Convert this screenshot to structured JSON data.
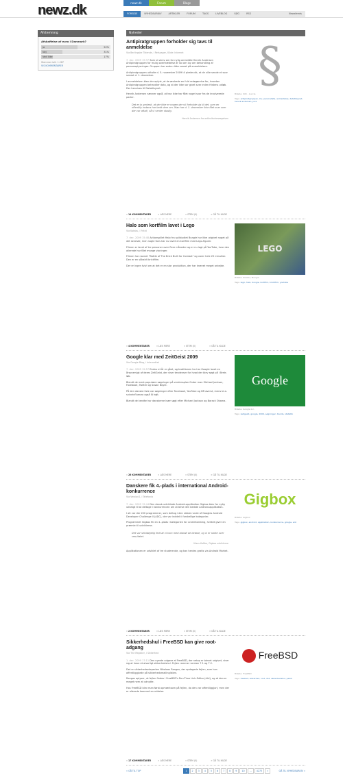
{
  "site": {
    "logo": "newz.dk",
    "top_tabs": [
      {
        "label": "newz.dk",
        "color": "#3a7ab8"
      },
      {
        "label": "Forum",
        "color": "#8fbf3a"
      },
      {
        "label": "Blogs",
        "color": "#999999"
      }
    ],
    "nav": [
      "FORSIDE",
      "NYHEDSARKIV",
      "ARTIKLER",
      "FORUM",
      "TAGS",
      "LIVEBLOG",
      "SØG",
      "RSS"
    ],
    "nav_right": "Newsfeeds"
  },
  "sidebar": {
    "title": "Afstemning",
    "question": "Afskaffelse af euro i Danmark?",
    "options": [
      {
        "label": "Ja",
        "percent": 52,
        "pct_text": "52%"
      },
      {
        "label": "Nej",
        "percent": 31,
        "pct_text": "31%"
      },
      {
        "label": "Ved ikke",
        "percent": 17,
        "pct_text": "17%"
      }
    ],
    "votes": "Stemmer ialt: 1.287",
    "link": "VIS KOMMENTARER"
  },
  "main": {
    "section_title": "Nyheder",
    "articles": [
      {
        "title": "Antipiratgruppen forholder sig tavs til anmeldelse",
        "meta": "Via Berlingske Tidende, i Retssager, Kilde: Internet",
        "date": "7. dec. 2009 19:37",
        "paragraphs": [
          "Som vi skrev om for nylig anmeldte Henrik Andersen Antipiratgruppen for mulig overtrædelse af lov om lov om behandling af personoplysninger. Gruppen har endnu ikke svaret på anmeldelsen.",
          "Antipiratgruppen udtalte d. 5. november 2009 til pirater.dk, at de ville sende et svar senest d. 1. december.",
          "I anmeldelsen blev der oplyst, at de ønskede en fuld redegørelse for, hvordan Antipiratgruppen behandler data, og at der ikke var givet svar inden fristens udløb. Der henvises til Datatilsynet.",
          "Henrik Andersen nævner også, at han ikke har fået noget svar fra de involverede parter."
        ],
        "quote": "Det er jo grotesk, at der ikke er nogen der vil forholde sig til det, som en offentlig instans har bedt dem om. Man har d. 1. december ikke fået svar som der var aftalt, så vi venter stadig.",
        "cite": "Henrik Andersen fra antikulturbevægelsen",
        "image": "§",
        "caption": "Billede: SXC - kuccia",
        "tags": "antipiratgruppen, lov, persondata, anmeldelse, datatilsynet, henrik andersen, jura",
        "comments": "14 KOMMENTARER",
        "read_more": "LÆS MERE",
        "vote": "STEM (0)",
        "source": "GÅ TIL KILDE"
      },
      {
        "title": "Halo som kortfilm lavet i Lego",
        "meta": "Via Kotaku, i Fritid",
        "date": "7. dec. 2009 15:48",
        "paragraphs": [
          "Actionspillet Halo fra spilstudiet Bungie har ikke udgivet noget på det seneste, men nogle fans har nu lavet en kortfilm med Lego-figurer.",
          "Filmen er lavet af tre personer over flere måneder og er nu lagt på YouTube, hvor den allerede har fået mange visninger.",
          "Filmen har navnet \"Battle of The Brick Built for Combat\" og varer hele 25 minutter. Den er en såkaldt brickfilm.",
          "Der er ingen tvivl om at det er en stor produktion, der har krævet meget arbejde."
        ],
        "image": "LEGO",
        "caption": "Billede: Kotaku / Bungie",
        "tags": "lego, halo, bungie, kortfilm, brickfilm, youtube",
        "comments": "4 KOMMENTARER",
        "read_more": "LÆS MERE",
        "vote": "STEM (0)",
        "source": "GÅ TIL KILDE"
      },
      {
        "title": "Google klar med ZeitGeist 2009",
        "meta": "Via Google Blog, i Internettet",
        "date": "7. dec. 2009 12:57",
        "paragraphs": [
          "Endnu et år er gået, og traditionen tro har Google lavet en årsoversigt af deres ZeitGeist, der viser tendenser for hvad der blev søgt på i årets løb.",
          "Blandt de mest populære søgninger på verdensplan finder man Michael Jackson, Facebook, Twitter og Susan Boyle.",
          "På den danske liste var søgninger efter Facebook, YouTube og DR øverst, mens bl.a. svineinfluenza også lå højt.",
          "Blandt de kendte har danskerne især søgt efter Michael Jackson og Barack Obama."
        ],
        "image": "Google",
        "caption": "Billede: Google Inc.",
        "tags": "zeitgeist, google, 2009, søgninger, trends, statistik",
        "comments": "26 KOMMENTARER",
        "read_more": "LÆS MERE",
        "vote": "STEM (0)",
        "source": "GÅ TIL KILDE"
      },
      {
        "title": "Danskere fik 4.-plads i international Android-konkurrence",
        "meta": "Via Version2, i Telefonia",
        "date": "7. dec. 2009 12:44",
        "paragraphs": [
          "Den dansk-udviklede Android-applikation Gigbox blev for nylig udvalgt til at deltage i konkurrencen om at blive den bedste Android-applikation.",
          "I alt var der 200 programmer, som deltog i den sidste runde af Googles Android Developer Challenge II (ADC), der var inddelt i forskellige kategorier.",
          "Programmet Gigbox fik en 4.-plads i kategorien for underholdning, hvilket giver en præmie til udviklerne."
        ],
        "quote": "Det var selvfølgelig fedt at vi kom med blandt de bedste, og vi er stolte over resultatet.",
        "cite": "Klaus Kaffee, Gigbox udviklerne",
        "extra": "Applikationen er udviklet af tre studerende, og kan hentes gratis via Android Market.",
        "image": "Gigbox",
        "caption": "Billede: Gigbox",
        "tags": "gigbox, android, applikation, konkurrence, google, adc",
        "comments": "2 KOMMENTARER",
        "read_more": "LÆS MERE",
        "vote": "STEM (0)",
        "source": "GÅ TIL KILDE"
      },
      {
        "title": "Sikkerhedshul i FreeBSD kan give root-adgang",
        "meta": "Via The Register, i Sikkerhed",
        "date": "1. dec. 2009 17:11",
        "paragraphs": [
          "Den nyeste udgave af FreeBSD, der netop er blevet udgivet, viser sig at have et alvorligt sikkerhedshul. Fejlen rammer version 7.1 og 7.2.",
          "Det er sikkerhedseksperten Nikolaos Rangos, der opdagede fejlen, som han offentliggjorde på sikkerhedsmailinglisten.",
          "Rangos oplyser, at fejlen findes i FreeBSD's Run-Time Link-Editor (rtld), og at den er meget nem at udnytte.",
          "Hos FreeBSD blev man først opmærksom på fejlen, da den var offentliggjort, men der er allerede kommet en rettelse."
        ],
        "image": "FreeBSD",
        "caption": "Billede: FreeBSD",
        "tags": "freebsd, sikkerhed, root, rtld, sikkerhedshul, patch",
        "comments": "17 KOMMENTARER",
        "read_more": "LÆS MERE",
        "vote": "STEM (0)",
        "source": "GÅ TIL KILDE"
      }
    ]
  },
  "pager": {
    "prev": "« GÅ TIL TOP",
    "pages": [
      "1",
      "2",
      "3",
      "4",
      "5",
      "6",
      "7",
      "8",
      "9",
      "10",
      "...",
      "4273",
      "»"
    ],
    "current": "1",
    "next": "GÅ TIL NYHEDSARKIV »"
  }
}
